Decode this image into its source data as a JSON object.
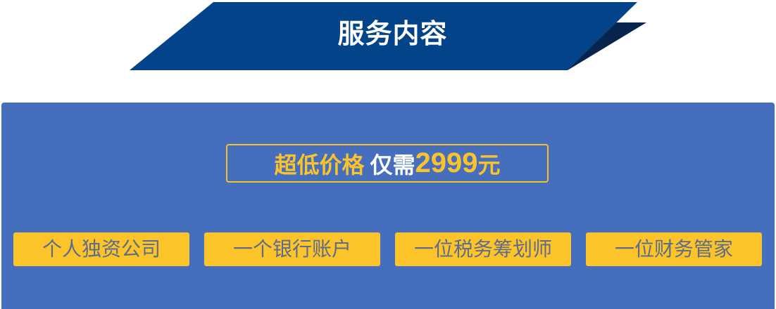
{
  "banner": {
    "title": "服务内容",
    "colors": {
      "main": "#03438a",
      "shadow": "#07244d"
    }
  },
  "pricing": {
    "label_highlight": "超低价格",
    "label_plain": "仅需",
    "price": "2999",
    "unit": "元"
  },
  "services": [
    {
      "label": "个人独资公司"
    },
    {
      "label": "一个银行账户"
    },
    {
      "label": "一位税务筹划师"
    },
    {
      "label": "一位财务管家"
    }
  ],
  "colors": {
    "panel": "#456ebd",
    "accent": "#fbc32b",
    "button_text": "#5b6c8c"
  }
}
